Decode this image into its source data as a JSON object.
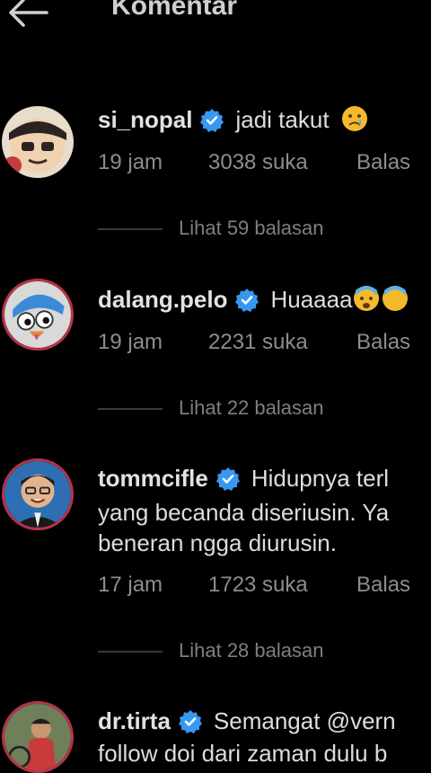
{
  "header": {
    "title": "Komentar",
    "back_icon": "arrow-left-icon"
  },
  "comments": [
    {
      "username": "si_nopal",
      "text": "jadi takut",
      "emoji": "crying-face-emoji",
      "time": "19 jam",
      "likes": "3038 suka",
      "reply": "Balas",
      "view_replies": "Lihat 59 balasan"
    },
    {
      "username": "dalang.pelo",
      "text": "Huaaaa",
      "emoji": "anxious-face-emoji",
      "time": "19 jam",
      "likes": "2231 suka",
      "reply": "Balas",
      "view_replies": "Lihat 22 balasan"
    },
    {
      "username": "tommcifle",
      "text": "Hidupnya terl",
      "text_line2": "yang becanda diseriusin. Ya",
      "text_line3": "beneran ngga diurusin.",
      "time": "17 jam",
      "likes": "1723 suka",
      "reply": "Balas",
      "view_replies": "Lihat 28 balasan"
    },
    {
      "username": "dr.tirta",
      "text": "Semangat @vern",
      "text_line2": "follow doi dari zaman dulu b"
    }
  ],
  "colors": {
    "verified": "#3897f0",
    "ring": "#b8324a",
    "background": "#000000"
  }
}
